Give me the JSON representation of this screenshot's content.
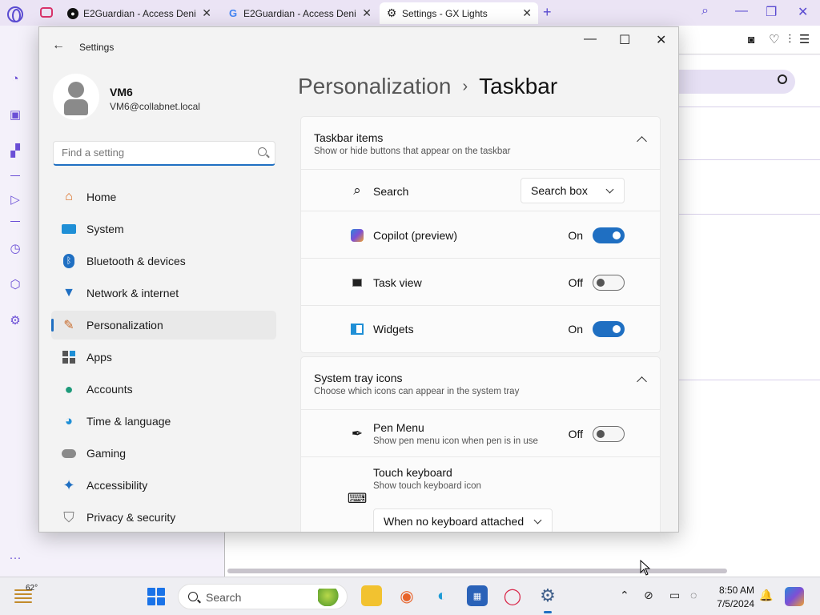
{
  "browser": {
    "tabs": [
      {
        "label": "E2Guardian - Access Denie",
        "icon": "github-icon",
        "active": false
      },
      {
        "label": "E2Guardian - Access Denie",
        "icon": "google-icon",
        "active": false
      },
      {
        "label": "Settings - GX Lights",
        "icon": "gear-icon",
        "active": true
      }
    ],
    "new_tab": "+",
    "accent": "#5a4bd1"
  },
  "settings": {
    "window_title": "Settings",
    "user": {
      "name": "VM6",
      "email": "VM6@collabnet.local"
    },
    "search_placeholder": "Find a setting",
    "nav": [
      {
        "label": "Home",
        "icon": "home-icon"
      },
      {
        "label": "System",
        "icon": "system-icon"
      },
      {
        "label": "Bluetooth & devices",
        "icon": "bluetooth-icon"
      },
      {
        "label": "Network & internet",
        "icon": "wifi-icon"
      },
      {
        "label": "Personalization",
        "icon": "brush-icon",
        "selected": true
      },
      {
        "label": "Apps",
        "icon": "apps-icon"
      },
      {
        "label": "Accounts",
        "icon": "account-icon"
      },
      {
        "label": "Time & language",
        "icon": "globe-clock-icon"
      },
      {
        "label": "Gaming",
        "icon": "gamepad-icon"
      },
      {
        "label": "Accessibility",
        "icon": "accessibility-icon"
      },
      {
        "label": "Privacy & security",
        "icon": "shield-icon"
      }
    ],
    "breadcrumb": {
      "parent": "Personalization",
      "separator": "›",
      "current": "Taskbar"
    },
    "taskbar_items": {
      "title": "Taskbar items",
      "subtitle": "Show or hide buttons that appear on the taskbar",
      "search": {
        "label": "Search",
        "value": "Search box"
      },
      "copilot": {
        "label": "Copilot (preview)",
        "state": "On",
        "enabled": true
      },
      "task_view": {
        "label": "Task view",
        "state": "Off",
        "enabled": false
      },
      "widgets": {
        "label": "Widgets",
        "state": "On",
        "enabled": true
      }
    },
    "system_tray": {
      "title": "System tray icons",
      "subtitle": "Choose which icons can appear in the system tray",
      "pen_menu": {
        "label": "Pen Menu",
        "sub": "Show pen menu icon when pen is in use",
        "state": "Off",
        "enabled": false
      },
      "touch_keyboard": {
        "label": "Touch keyboard",
        "sub": "Show touch keyboard icon",
        "value": "When no keyboard attached"
      }
    },
    "accent": "#1f6fc2"
  },
  "taskbar": {
    "weather": "62°",
    "search_label": "Search",
    "clock": {
      "time": "8:50 AM",
      "date": "7/5/2024"
    }
  }
}
